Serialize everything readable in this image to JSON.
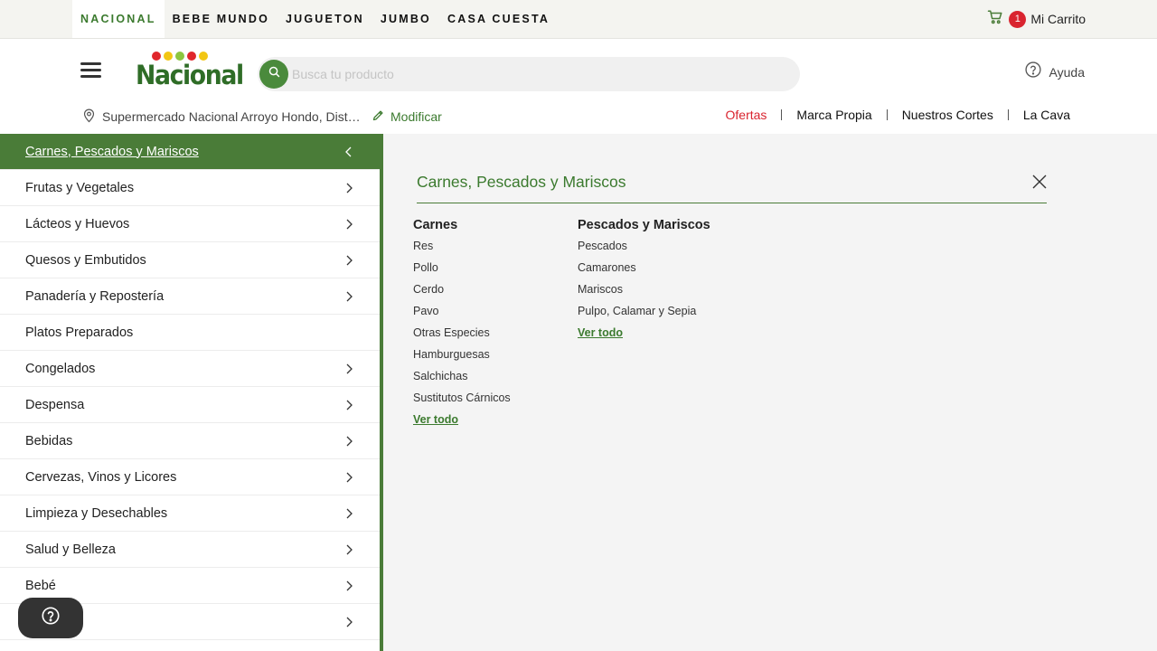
{
  "topbar": {
    "brands": [
      "NACIONAL",
      "BEBE MUNDO",
      "JUGUETON",
      "JUMBO",
      "CASA CUESTA"
    ],
    "cart_count": "1",
    "cart_label": "Mi Carrito"
  },
  "header": {
    "logo_text": "Nacional",
    "search_placeholder": "Busca tu producto",
    "search_value": "",
    "help_label": "Ayuda",
    "location": "Supermercado Nacional Arroyo Hondo, Distrito Nacional",
    "modify_label": "Modificar",
    "quicklinks": [
      "Ofertas",
      "Marca Propia",
      "Nuestros Cortes",
      "La Cava"
    ]
  },
  "categories": [
    {
      "label": "Carnes, Pescados y Mariscos"
    },
    {
      "label": "Frutas y Vegetales"
    },
    {
      "label": "Lácteos y Huevos"
    },
    {
      "label": "Quesos y Embutidos"
    },
    {
      "label": "Panadería y Repostería"
    },
    {
      "label": "Platos Preparados"
    },
    {
      "label": "Congelados"
    },
    {
      "label": "Despensa"
    },
    {
      "label": "Bebidas"
    },
    {
      "label": "Cervezas, Vinos y Licores"
    },
    {
      "label": "Limpieza y Desechables"
    },
    {
      "label": "Salud y Belleza"
    },
    {
      "label": "Bebé"
    },
    {
      "label": ""
    }
  ],
  "panel": {
    "title": "Carnes, Pescados y Mariscos",
    "columns": [
      {
        "heading": "Carnes",
        "links": [
          "Res",
          "Pollo",
          "Cerdo",
          "Pavo",
          "Otras Especies",
          "Hamburguesas",
          "Salchichas",
          "Sustitutos Cárnicos"
        ],
        "see_all": "Ver todo"
      },
      {
        "heading": "Pescados y Mariscos",
        "links": [
          "Pescados",
          "Camarones",
          "Mariscos",
          "Pulpo, Calamar y Sepia"
        ],
        "see_all": "Ver todo"
      }
    ]
  },
  "colors": {
    "brand_green": "#3b7a2e",
    "menu_active": "#4a7c38",
    "accent_red": "#d9242f"
  },
  "icons": [
    "cart-icon",
    "menu-icon",
    "search-icon",
    "help-circle-icon",
    "location-pin-icon",
    "pencil-icon",
    "chevron-right-icon",
    "chevron-left-icon",
    "close-icon",
    "question-icon"
  ]
}
